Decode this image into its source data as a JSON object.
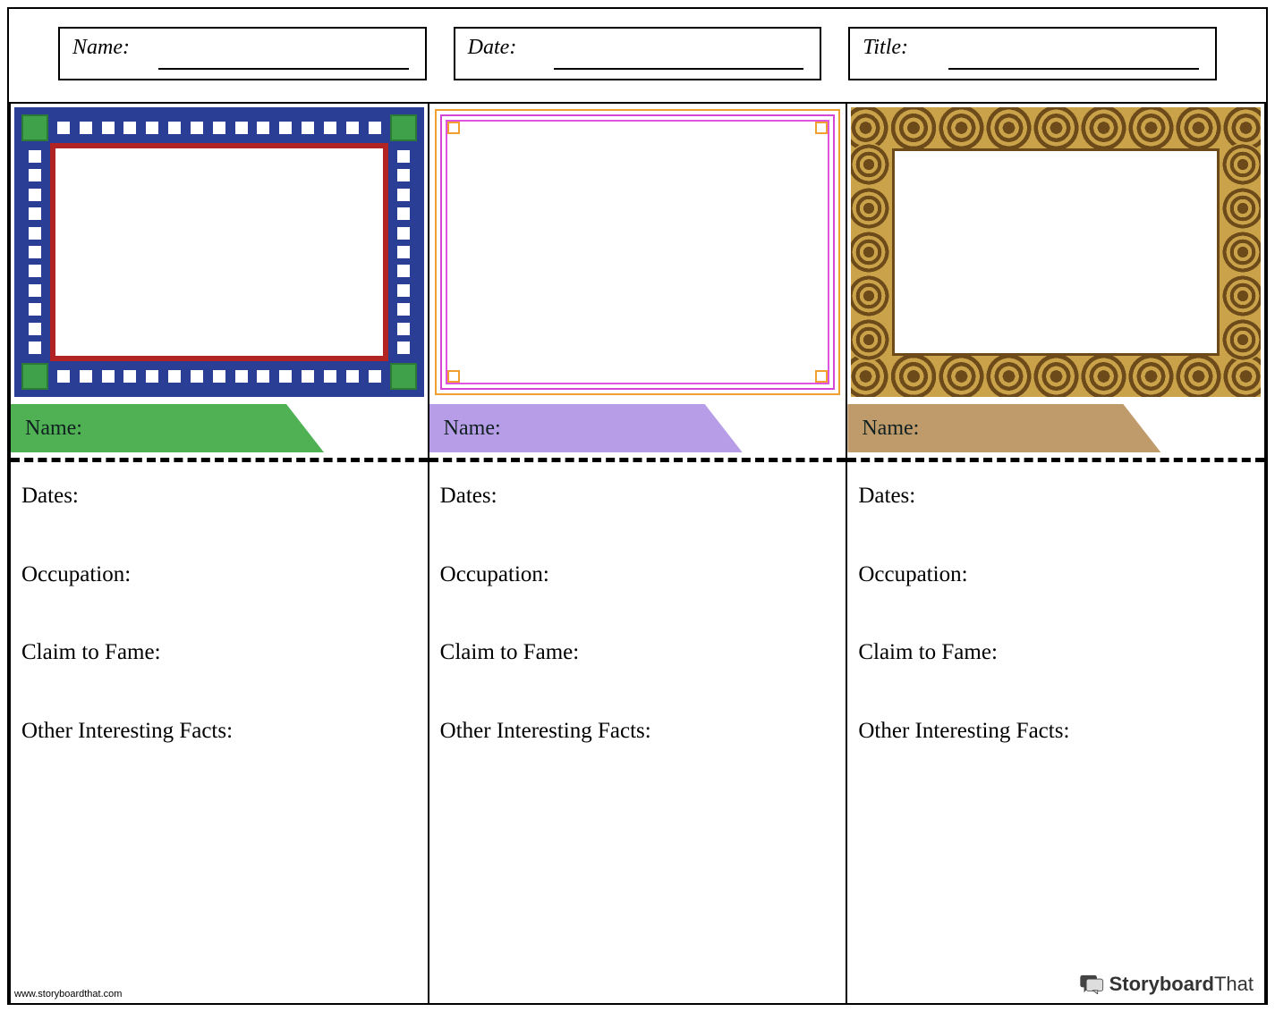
{
  "header": {
    "name_label": "Name:",
    "date_label": "Date:",
    "title_label": "Title:"
  },
  "cards": [
    {
      "tag_color": "#4fb154",
      "name_label": "Name:",
      "fields": {
        "dates": "Dates:",
        "occupation": "Occupation:",
        "claim": "Claim to Fame:",
        "facts": "Other Interesting Facts:"
      }
    },
    {
      "tag_color": "#b79de8",
      "name_label": "Name:",
      "fields": {
        "dates": "Dates:",
        "occupation": "Occupation:",
        "claim": "Claim to Fame:",
        "facts": "Other Interesting Facts:"
      }
    },
    {
      "tag_color": "#bf9b6b",
      "name_label": "Name:",
      "fields": {
        "dates": "Dates:",
        "occupation": "Occupation:",
        "claim": "Claim to Fame:",
        "facts": "Other Interesting Facts:"
      }
    }
  ],
  "footer": {
    "url": "www.storyboardthat.com",
    "brand_a": "Storyboard",
    "brand_b": "That"
  }
}
